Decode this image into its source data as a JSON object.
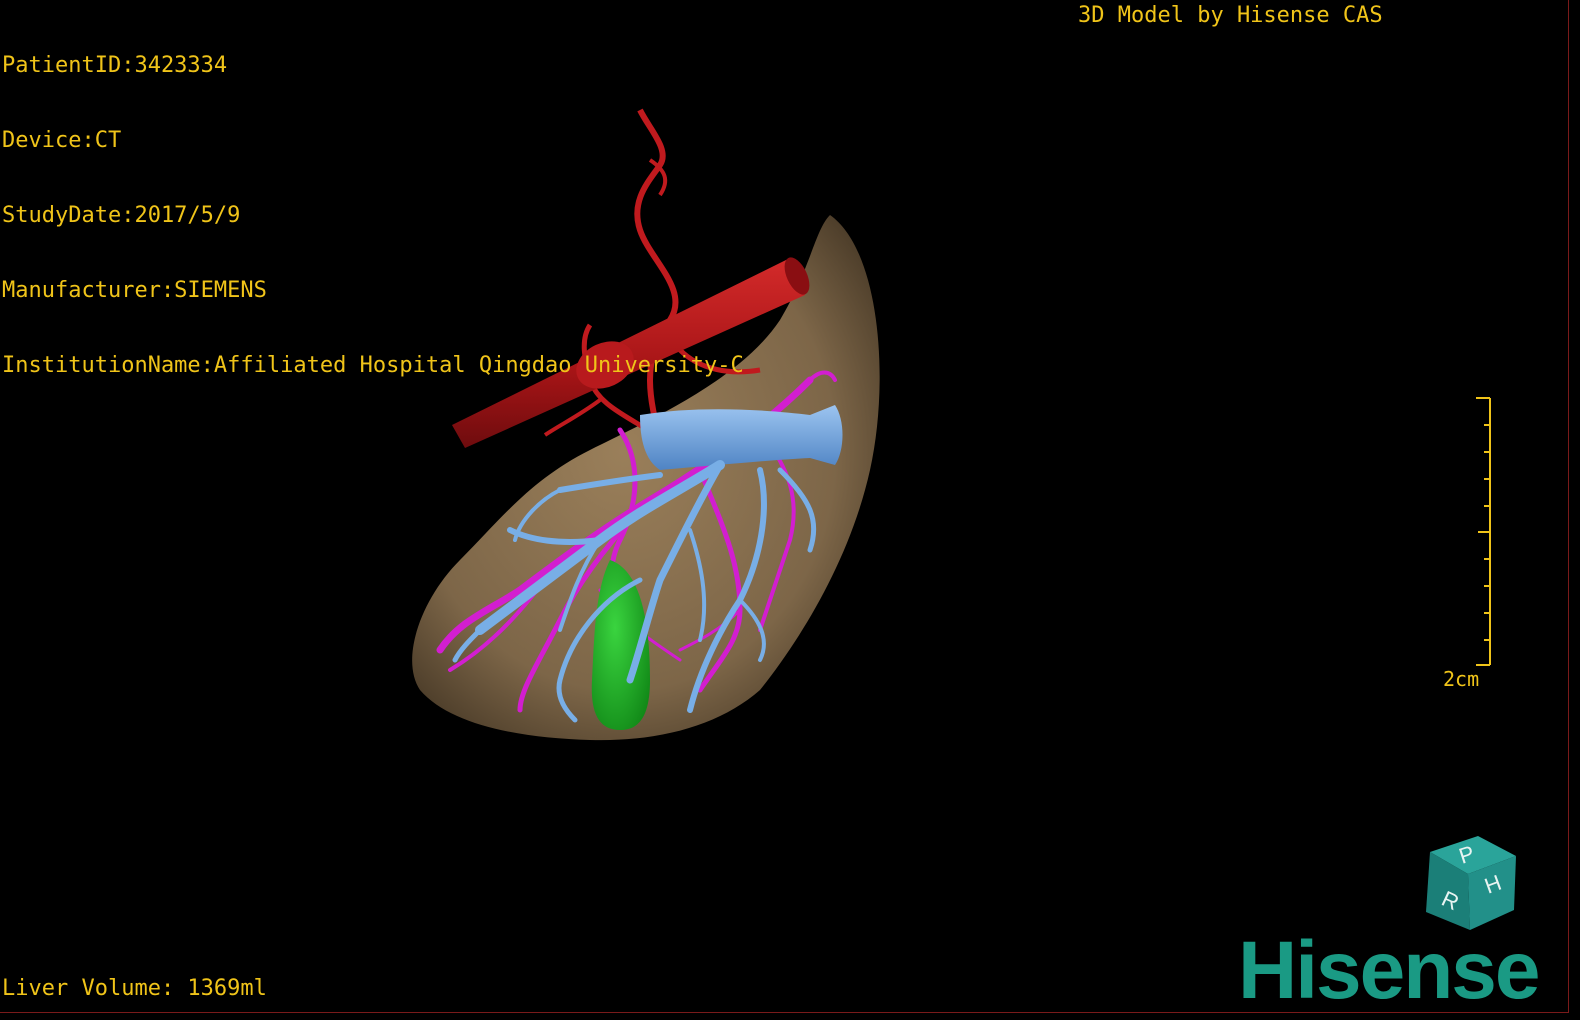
{
  "info": {
    "patient_id": "PatientID:3423334",
    "device": "Device:CT",
    "study_date": "StudyDate:2017/5/9",
    "manufacturer": "Manufacturer:SIEMENS",
    "institution": "InstitutionName:Affiliated Hospital Qingdao University-C"
  },
  "credit": "3D Model by Hisense CAS",
  "liver_volume": "Liver Volume: 1369ml",
  "scale_bar": {
    "label": "2cm"
  },
  "orientation_cube": {
    "faces": [
      "P",
      "H",
      "R"
    ],
    "color": "#1f8f86"
  },
  "brand": "Hisense",
  "colors": {
    "overlay_text": "#f0c419",
    "liver": "#8a7150",
    "aorta": "#b3161a",
    "portal_vein": "#6fa3dc",
    "hepatic_vein": "#d21ed0",
    "gallbladder": "#21b62a",
    "brand": "#1a9a84"
  }
}
